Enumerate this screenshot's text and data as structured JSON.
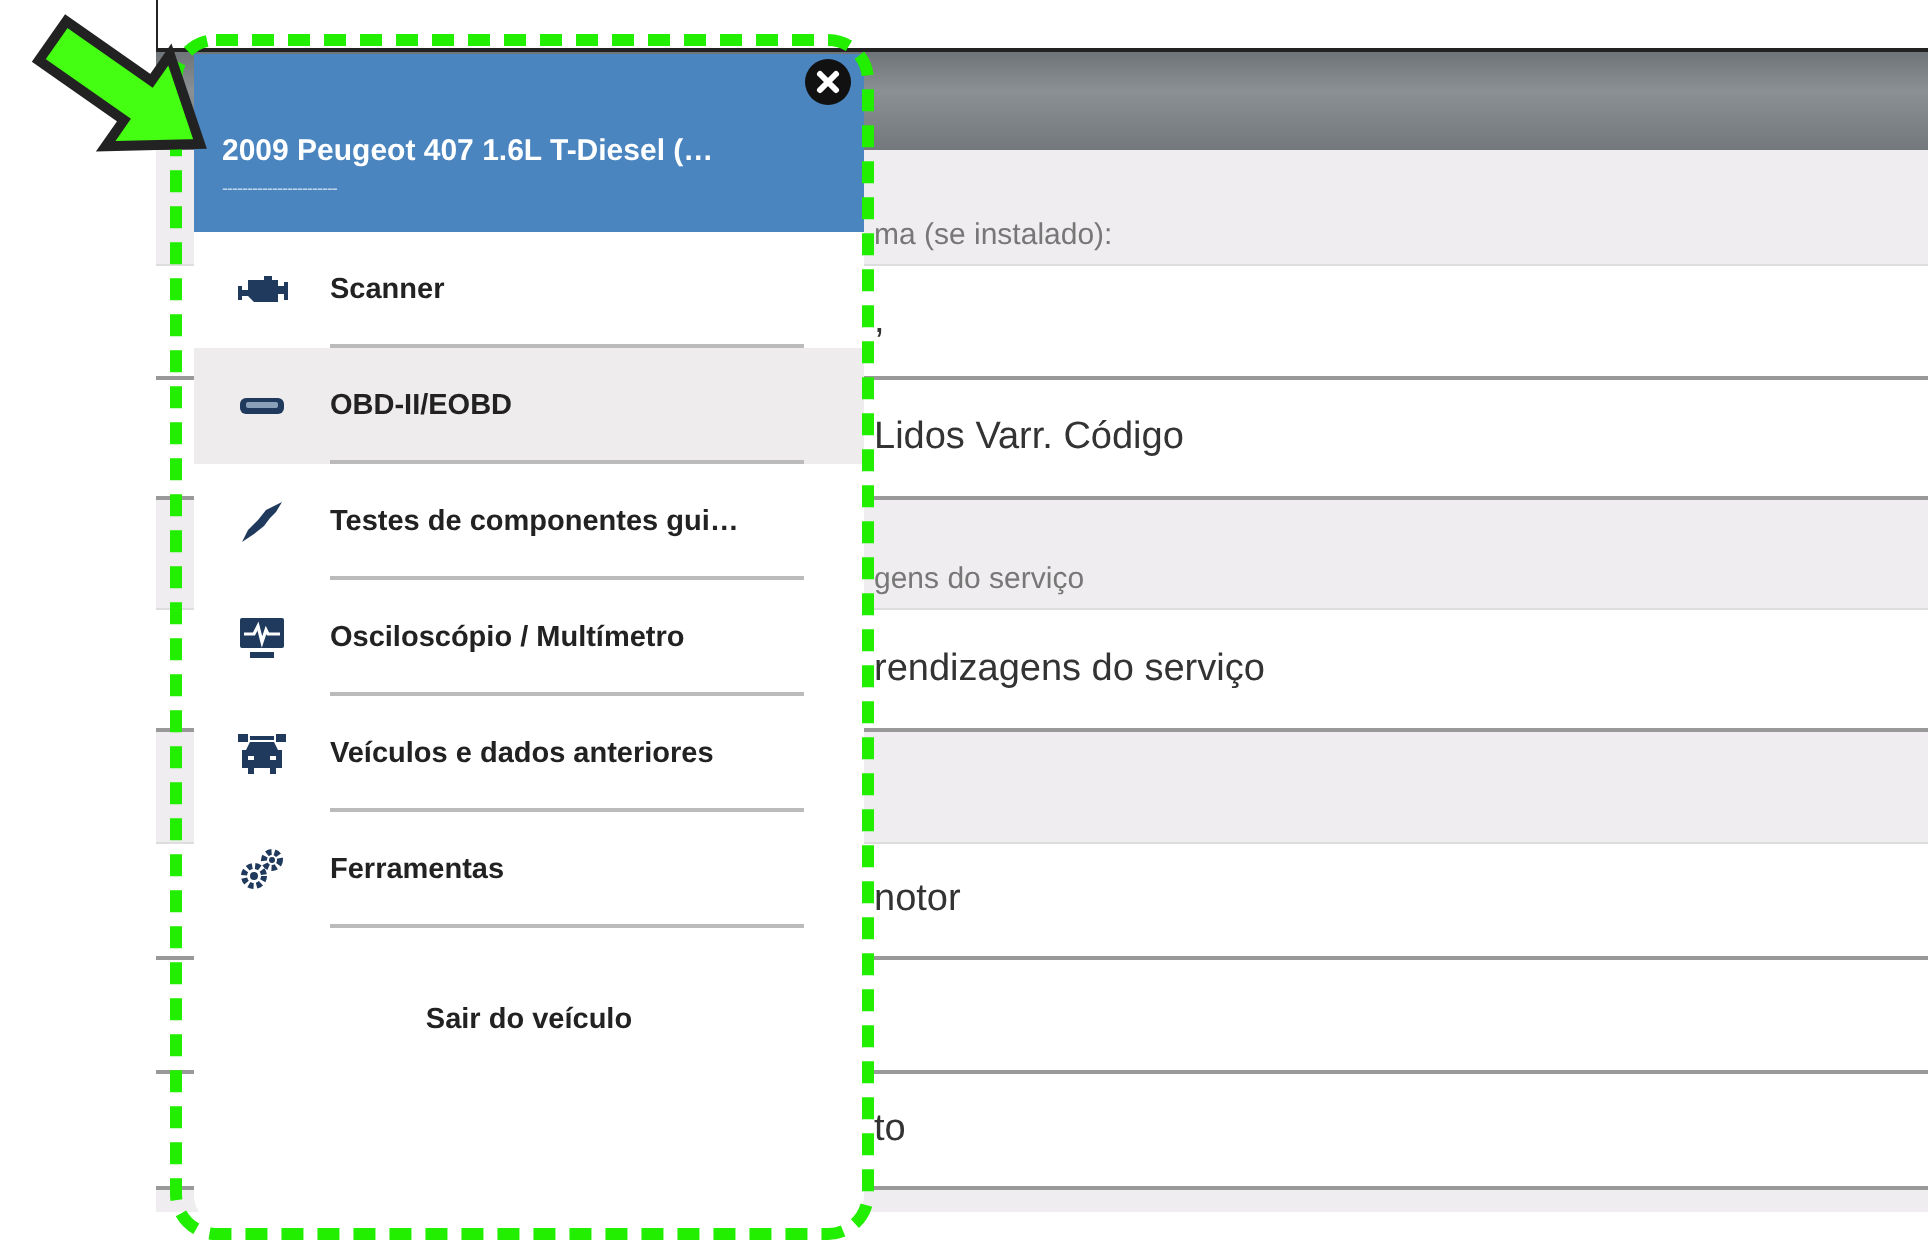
{
  "background": {
    "rows": [
      {
        "kind": "section",
        "text": "ma (se instalado):"
      },
      {
        "kind": "item",
        "text": ","
      },
      {
        "kind": "item",
        "text": "Lidos Varr. Código"
      },
      {
        "kind": "section",
        "text": "gens do serviço"
      },
      {
        "kind": "item",
        "text": "rendizagens do serviço"
      },
      {
        "kind": "section"
      },
      {
        "kind": "item",
        "text": "notor"
      },
      {
        "kind": "item"
      },
      {
        "kind": "item",
        "text": "to"
      }
    ]
  },
  "drawer": {
    "title": "2009 Peugeot 407 1.6L T-Diesel (…",
    "subtitle": "-----------------------",
    "items": [
      {
        "label": "Scanner",
        "kind": "engine",
        "selected": false
      },
      {
        "label": "OBD-II/EOBD",
        "kind": "connector",
        "selected": true
      },
      {
        "label": "Testes de componentes gui…",
        "kind": "probe",
        "selected": false
      },
      {
        "label": "Osciloscópio / Multímetro",
        "kind": "scope",
        "selected": false
      },
      {
        "label": "Veículos e dados anteriores",
        "kind": "vehicle",
        "selected": false
      },
      {
        "label": "Ferramentas",
        "kind": "gears",
        "selected": false
      }
    ],
    "exit": "Sair do veículo"
  }
}
